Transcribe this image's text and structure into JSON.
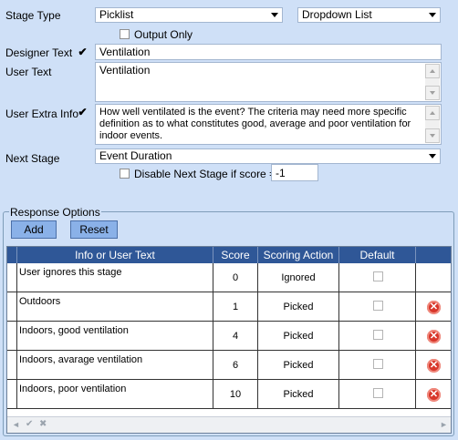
{
  "stage_type": {
    "label": "Stage Type",
    "value": "Picklist",
    "control": "Dropdown List",
    "output_only": "Output Only"
  },
  "designer_text": {
    "label": "Designer Text",
    "checked": true,
    "value": "Ventilation"
  },
  "user_text": {
    "label": "User Text",
    "value": "Ventilation"
  },
  "user_extra_info": {
    "label": "User Extra Info",
    "checked": true,
    "value": "How well ventilated is the event? The criteria may need more specific definition as to what constitutes good, average and poor ventilation for indoor events."
  },
  "next_stage": {
    "label": "Next Stage",
    "value": "Event Duration",
    "disable_label": "Disable Next Stage if score =",
    "disable_value": "-1"
  },
  "response_options": {
    "title": "Response Options",
    "add": "Add",
    "reset": "Reset",
    "columns": [
      "Info or User Text",
      "Score",
      "Scoring Action",
      "Default"
    ],
    "rows": [
      {
        "text": "User ignores this stage",
        "score": "0",
        "action": "Ignored",
        "deletable": false
      },
      {
        "text": "Outdoors",
        "score": "1",
        "action": "Picked",
        "deletable": true
      },
      {
        "text": "Indoors, good ventilation",
        "score": "4",
        "action": "Picked",
        "deletable": true
      },
      {
        "text": "Indoors, avarage ventilation",
        "score": "6",
        "action": "Picked",
        "deletable": true
      },
      {
        "text": "Indoors, poor ventilation",
        "score": "10",
        "action": "Picked",
        "deletable": true
      }
    ]
  },
  "colors": {
    "background": "#cfe0f7",
    "header": "#2f5797",
    "button": "#8ab1e8",
    "delete": "#d8362a"
  }
}
